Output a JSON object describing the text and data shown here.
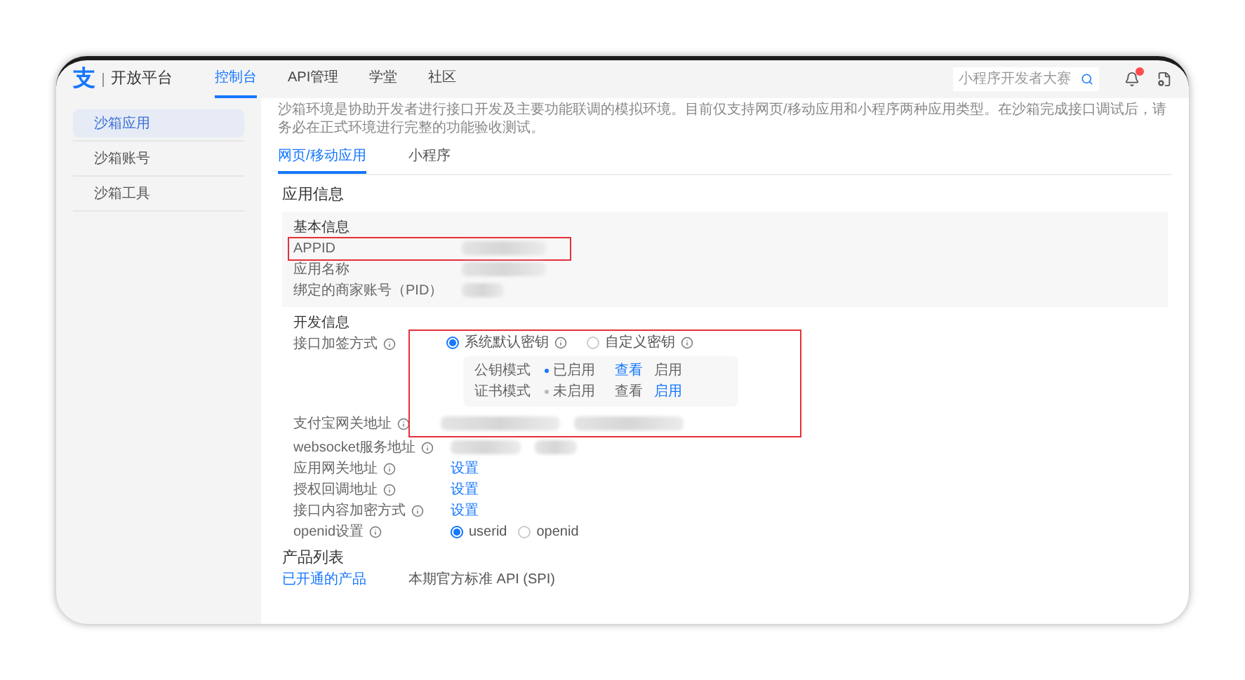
{
  "header": {
    "logo_mark": "支",
    "logo_text": "开放平台",
    "nav": [
      {
        "label": "控制台",
        "selected": true
      },
      {
        "label": "API管理",
        "selected": false
      },
      {
        "label": "学堂",
        "selected": false
      },
      {
        "label": "社区",
        "selected": false
      }
    ],
    "search": {
      "placeholder": "小程序开发者大赛"
    },
    "notification_badge": true
  },
  "sidebar": {
    "items": [
      {
        "label": "沙箱应用",
        "selected": true
      },
      {
        "label": "沙箱账号",
        "selected": false
      },
      {
        "label": "沙箱工具",
        "selected": false
      }
    ]
  },
  "notice": "沙箱环境是协助开发者进行接口开发及主要功能联调的模拟环境。目前仅支持网页/移动应用和小程序两种应用类型。在沙箱完成接口调试后，请务必在正式环境进行完整的功能验收测试。",
  "tabs": [
    {
      "label": "网页/移动应用",
      "selected": true
    },
    {
      "label": "小程序",
      "selected": false
    }
  ],
  "section_title": "应用信息",
  "basic_info": {
    "title": "基本信息",
    "fields": [
      {
        "label": "APPID",
        "annotated": true
      },
      {
        "label": "应用名称",
        "annotated": false
      },
      {
        "label": "绑定的商家账号（PID）",
        "annotated": false
      }
    ]
  },
  "dev_info": {
    "title": "开发信息",
    "annotated": true,
    "sign_method": {
      "label": "接口加签方式",
      "options": [
        {
          "label": "系统默认密钥",
          "selected": true
        },
        {
          "label": "自定义密钥",
          "selected": false
        }
      ],
      "modes": [
        {
          "name": "公钥模式",
          "status": "已启用",
          "enabled": true,
          "actions": [
            {
              "label": "查看",
              "active": true
            },
            {
              "label": "启用",
              "active": false
            }
          ]
        },
        {
          "name": "证书模式",
          "status": "未启用",
          "enabled": false,
          "actions": [
            {
              "label": "查看",
              "active": false
            },
            {
              "label": "启用",
              "active": true
            }
          ]
        }
      ]
    },
    "fields": [
      {
        "label": "支付宝网关地址",
        "kind": "redacted"
      },
      {
        "label": "websocket服务地址",
        "kind": "redacted"
      },
      {
        "label": "应用网关地址",
        "kind": "link",
        "value": "设置"
      },
      {
        "label": "授权回调地址",
        "kind": "link",
        "value": "设置"
      },
      {
        "label": "接口内容加密方式",
        "kind": "link",
        "value": "设置"
      },
      {
        "label": "openid设置",
        "kind": "radio",
        "options": [
          {
            "label": "userid",
            "selected": true
          },
          {
            "label": "openid",
            "selected": false
          }
        ]
      }
    ]
  },
  "products": {
    "title": "产品列表",
    "tabs": [
      {
        "label": "已开通的产品",
        "selected": true
      },
      {
        "label": "本期官方标准 API (SPI)",
        "selected": false
      }
    ]
  }
}
